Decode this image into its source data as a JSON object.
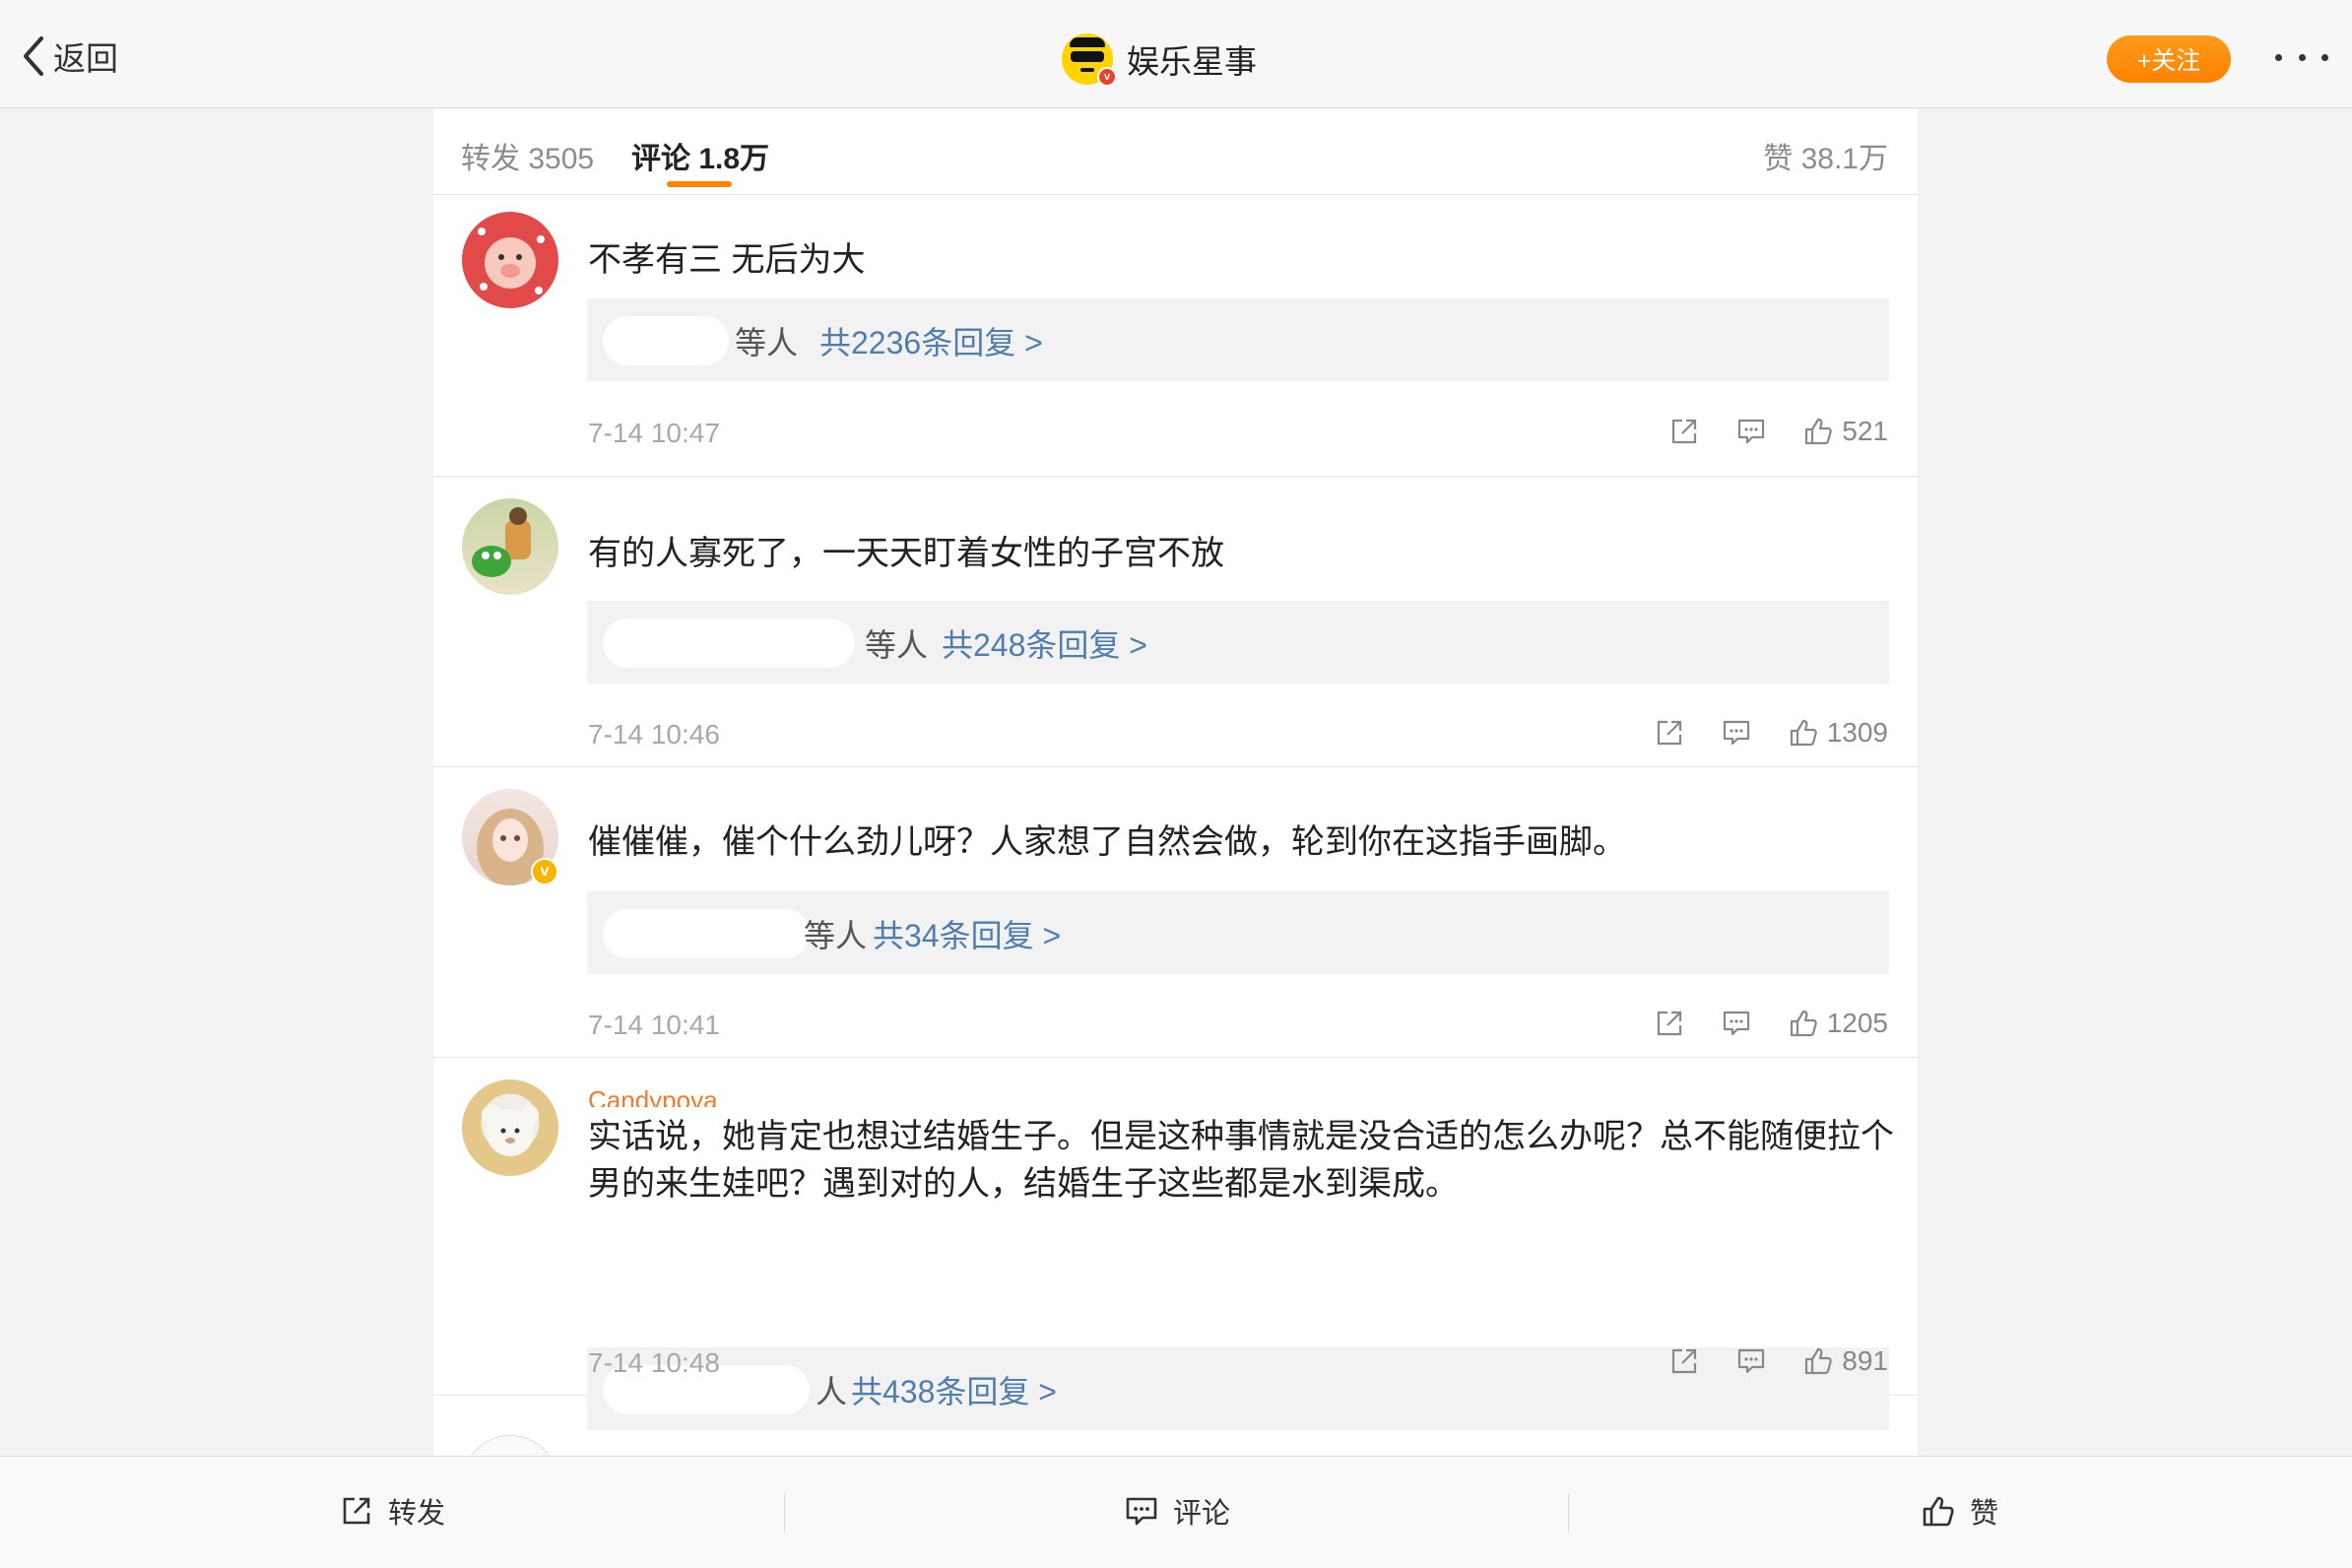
{
  "topbar": {
    "back_label": "返回",
    "account_name": "娱乐星事",
    "follow_label": "+关注"
  },
  "tabs": {
    "repost": "转发 3505",
    "comment": "评论 1.8万",
    "like": "赞 38.1万"
  },
  "comments": [
    {
      "username": "",
      "text": "不孝有三 无后为大",
      "reply_suffix": "等人",
      "reply_link": "共2236条回复 >",
      "time": "7-14 10:47",
      "likes": "521"
    },
    {
      "username": "",
      "text": "有的人寡死了，一天天盯着女性的子宫不放",
      "reply_suffix": "等人",
      "reply_link": "共248条回复 >",
      "time": "7-14 10:46",
      "likes": "1309"
    },
    {
      "username": "",
      "text": "催催催，催个什么劲儿呀？人家想了自然会做，轮到你在这指手画脚。",
      "reply_suffix": "等人",
      "reply_link": "共34条回复 >",
      "time": "7-14 10:41",
      "likes": "1205"
    },
    {
      "username": "Candypova",
      "text": "实话说，她肯定也想过结婚生子。但是这种事情就是没合适的怎么办呢？总不能随便拉个男的来生娃吧？遇到对的人，结婚生子这些都是水到渠成。",
      "reply_suffix": "人",
      "reply_link": "共438条回复 >",
      "time": "7-14 10:48",
      "likes": "891"
    }
  ],
  "bottombar": {
    "repost": "转发",
    "comment": "评论",
    "like": "赞"
  },
  "icons": {
    "back": "chevron-left-icon",
    "more": "more-dots-icon",
    "repost": "share-arrow-icon",
    "comment": "comment-bubble-icon",
    "like": "thumbs-up-icon"
  },
  "colors": {
    "accent": "#ff8200",
    "link": "#507daf",
    "username": "#f07b2a"
  }
}
